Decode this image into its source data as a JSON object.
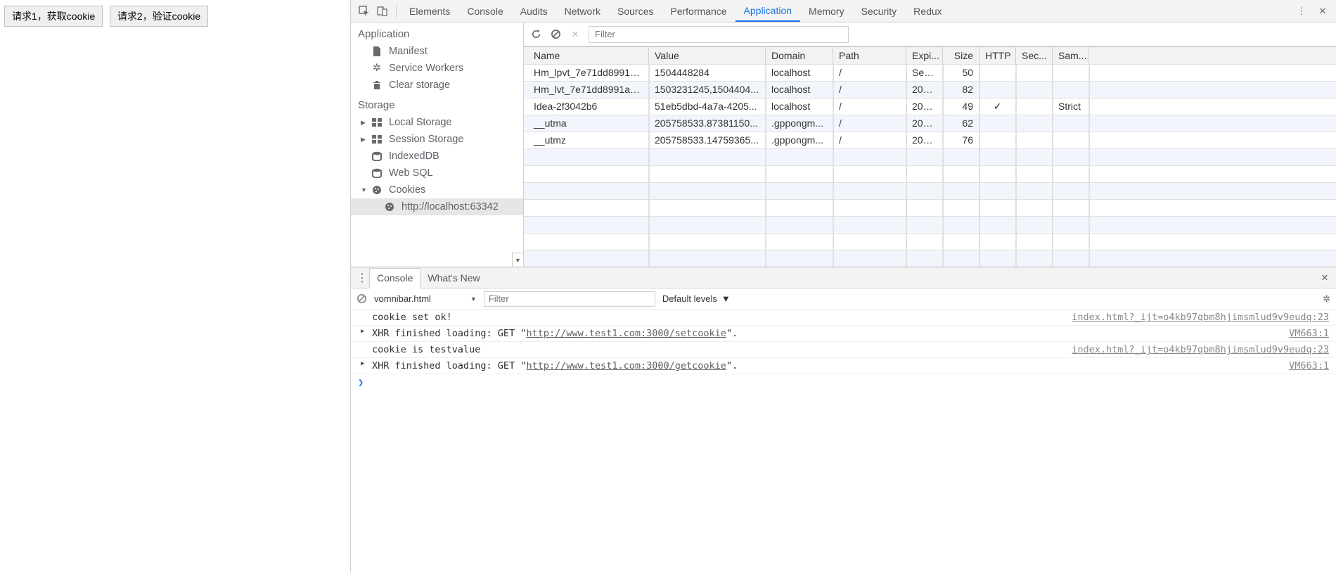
{
  "buttons": {
    "req1": "请求1，获取cookie",
    "req2": "请求2，验证cookie"
  },
  "tabs": [
    "Elements",
    "Console",
    "Audits",
    "Network",
    "Sources",
    "Performance",
    "Application",
    "Memory",
    "Security",
    "Redux"
  ],
  "activeTab": "Application",
  "sidebar": {
    "app_hdr": "Application",
    "app_items": [
      "Manifest",
      "Service Workers",
      "Clear storage"
    ],
    "storage_hdr": "Storage",
    "storage_items": [
      "Local Storage",
      "Session Storage",
      "IndexedDB",
      "Web SQL",
      "Cookies"
    ],
    "cookie_origin": "http://localhost:63342"
  },
  "toolbar": {
    "filter_ph": "Filter"
  },
  "grid": {
    "headers": [
      "Name",
      "Value",
      "Domain",
      "Path",
      "Expi...",
      "Size",
      "HTTP",
      "Sec...",
      "Sam..."
    ],
    "rows": [
      {
        "name": "Hm_lpvt_7e71dd8991a...",
        "value": "1504448284",
        "domain": "localhost",
        "path": "/",
        "exp": "Sess...",
        "size": "50",
        "http": "",
        "sec": "",
        "same": ""
      },
      {
        "name": "Hm_lvt_7e71dd8991a7...",
        "value": "1503231245,1504404...",
        "domain": "localhost",
        "path": "/",
        "exp": "201...",
        "size": "82",
        "http": "",
        "sec": "",
        "same": ""
      },
      {
        "name": "Idea-2f3042b6",
        "value": "51eb5dbd-4a7a-4205...",
        "domain": "localhost",
        "path": "/",
        "exp": "202...",
        "size": "49",
        "http": "✓",
        "sec": "",
        "same": "Strict"
      },
      {
        "name": "__utma",
        "value": "205758533.87381150...",
        "domain": ".gppongm...",
        "path": "/",
        "exp": "201...",
        "size": "62",
        "http": "",
        "sec": "",
        "same": ""
      },
      {
        "name": "__utmz",
        "value": "205758533.14759365...",
        "domain": ".gppongm...",
        "path": "/",
        "exp": "201...",
        "size": "76",
        "http": "",
        "sec": "",
        "same": ""
      }
    ]
  },
  "drawer": {
    "tabs": [
      "Console",
      "What's New"
    ],
    "activeTab": "Console",
    "context": "vomnibar.html",
    "filter_ph": "Filter",
    "levels": "Default levels",
    "lines": [
      {
        "type": "log",
        "text": "cookie set ok!",
        "loc": "index.html?_ijt=o4kb97qbm8hjimsmlud9v9eudq:23"
      },
      {
        "type": "xhr",
        "prefix": "XHR finished loading: GET \"",
        "url": "http://www.test1.com:3000/setcookie",
        "suffix": "\".",
        "loc": "VM663:1"
      },
      {
        "type": "log",
        "text": "cookie is testvalue",
        "loc": "index.html?_ijt=o4kb97qbm8hjimsmlud9v9eudq:23"
      },
      {
        "type": "xhr",
        "prefix": "XHR finished loading: GET \"",
        "url": "http://www.test1.com:3000/getcookie",
        "suffix": "\".",
        "loc": "VM663:1"
      }
    ]
  }
}
